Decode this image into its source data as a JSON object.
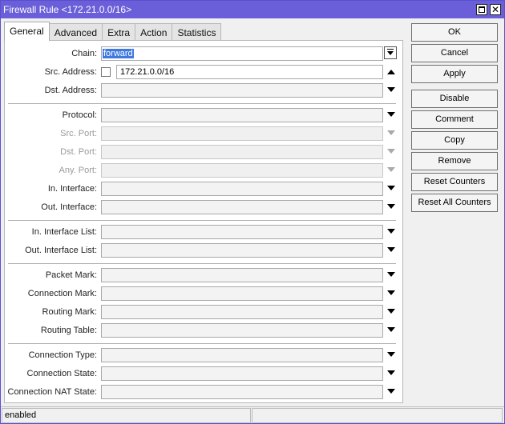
{
  "window": {
    "title": "Firewall Rule <172.21.0.0/16>"
  },
  "title_buttons": {
    "restore_icon": "restore-icon",
    "close_icon": "close-icon"
  },
  "tabs": [
    {
      "label": "General",
      "active": true
    },
    {
      "label": "Advanced",
      "active": false
    },
    {
      "label": "Extra",
      "active": false
    },
    {
      "label": "Action",
      "active": false
    },
    {
      "label": "Statistics",
      "active": false
    }
  ],
  "form": {
    "chain": {
      "label": "Chain:",
      "value": "forward"
    },
    "src_address": {
      "label": "Src. Address:",
      "value": "172.21.0.0/16"
    },
    "dst_address": {
      "label": "Dst. Address:"
    },
    "protocol": {
      "label": "Protocol:"
    },
    "src_port": {
      "label": "Src. Port:"
    },
    "dst_port": {
      "label": "Dst. Port:"
    },
    "any_port": {
      "label": "Any. Port:"
    },
    "in_interface": {
      "label": "In. Interface:"
    },
    "out_interface": {
      "label": "Out. Interface:"
    },
    "in_interface_list": {
      "label": "In. Interface List:"
    },
    "out_interface_list": {
      "label": "Out. Interface List:"
    },
    "packet_mark": {
      "label": "Packet Mark:"
    },
    "connection_mark": {
      "label": "Connection Mark:"
    },
    "routing_mark": {
      "label": "Routing Mark:"
    },
    "routing_table": {
      "label": "Routing Table:"
    },
    "connection_type": {
      "label": "Connection Type:"
    },
    "connection_state": {
      "label": "Connection State:"
    },
    "connection_nat_state": {
      "label": "Connection NAT State:"
    }
  },
  "buttons": {
    "ok": "OK",
    "cancel": "Cancel",
    "apply": "Apply",
    "disable": "Disable",
    "comment": "Comment",
    "copy": "Copy",
    "remove": "Remove",
    "reset_counters": "Reset Counters",
    "reset_all_counters": "Reset All Counters"
  },
  "status": {
    "state": "enabled",
    "secondary": ""
  },
  "colors": {
    "titlebar": "#6a5fd8",
    "selection": "#3f79e0"
  }
}
